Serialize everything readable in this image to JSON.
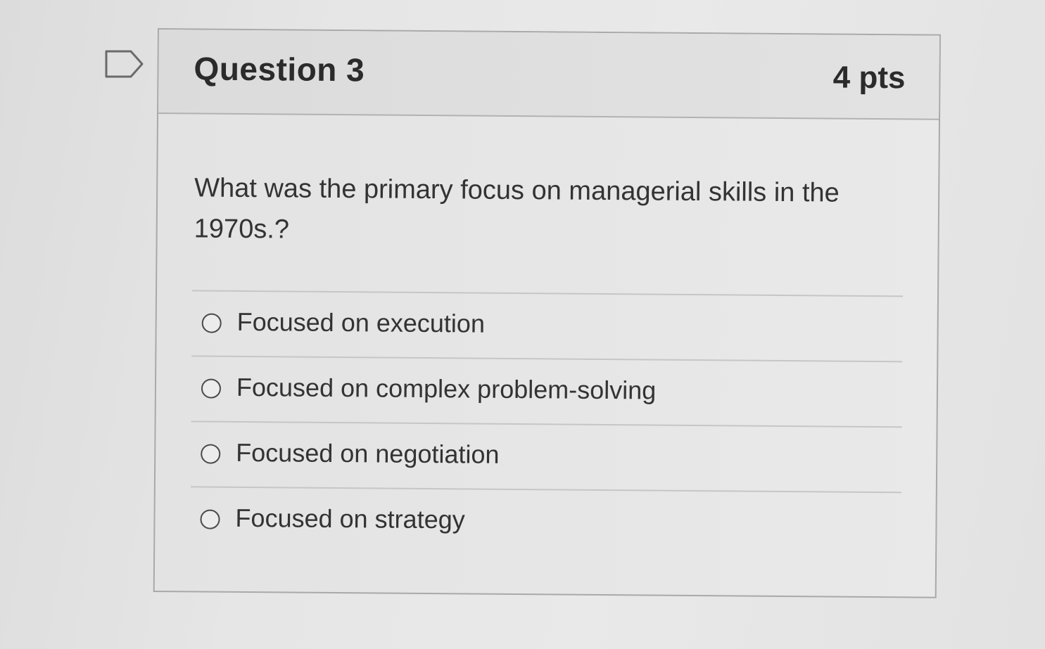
{
  "question": {
    "title": "Question 3",
    "points": "4 pts",
    "text": "What was the primary focus on managerial skills in the 1970s.?",
    "flag_icon": "flag-outline-icon"
  },
  "answers": [
    {
      "label": "Focused on execution",
      "selected": false
    },
    {
      "label": "Focused on complex problem-solving",
      "selected": false
    },
    {
      "label": "Focused on negotiation",
      "selected": false
    },
    {
      "label": "Focused on strategy",
      "selected": false
    }
  ],
  "colors": {
    "text": "#333333",
    "border": "#a9a9a9",
    "header_bg": "#dfdfdf",
    "card_bg": "#e6e6e6"
  }
}
